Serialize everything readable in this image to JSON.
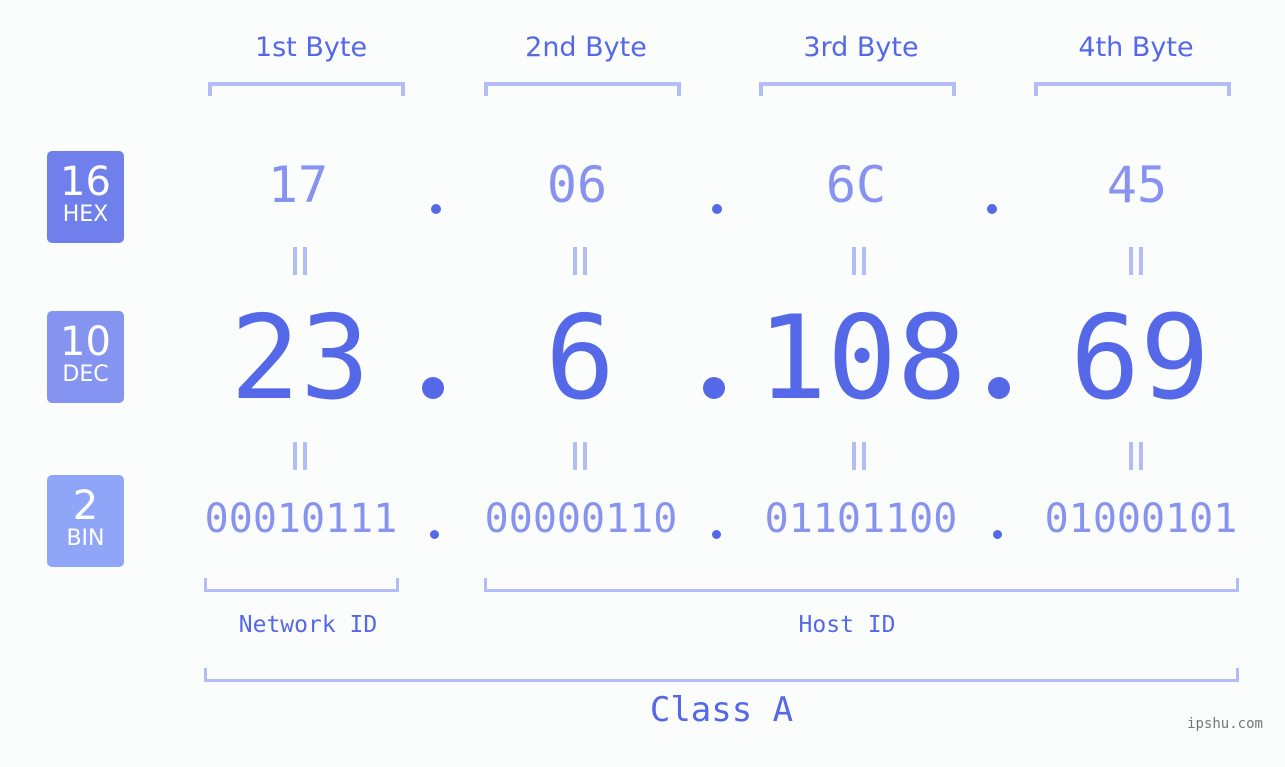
{
  "colors": {
    "accent": "#5468e8",
    "light_accent": "#8793ee",
    "bracket": "#b3bcf5",
    "hex_badge": "#6f80ec",
    "dec_badge": "#8494f0",
    "bin_badge": "#8fa6f8",
    "background": "#fbfdfc"
  },
  "bytes": [
    {
      "label": "1st Byte",
      "hex": "17",
      "dec": "23",
      "bin": "00010111"
    },
    {
      "label": "2nd Byte",
      "hex": "06",
      "dec": "6",
      "bin": "00000110"
    },
    {
      "label": "3rd Byte",
      "hex": "6C",
      "dec": "108",
      "bin": "01101100"
    },
    {
      "label": "4th Byte",
      "hex": "45",
      "dec": "69",
      "bin": "01000101"
    }
  ],
  "badges": {
    "hex": {
      "base": "16",
      "name": "HEX"
    },
    "dec": {
      "base": "10",
      "name": "DEC"
    },
    "bin": {
      "base": "2",
      "name": "BIN"
    }
  },
  "separator": ".",
  "network_id_label": "Network ID",
  "host_id_label": "Host ID",
  "class_label": "Class A",
  "watermark": "ipshu.com"
}
